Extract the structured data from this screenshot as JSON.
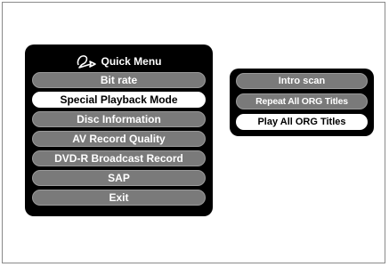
{
  "quick_menu": {
    "title": "Quick Menu",
    "logo_icon": "pioneer-logo-icon",
    "items": [
      {
        "label": "Bit rate",
        "selected": false
      },
      {
        "label": "Special Playback Mode",
        "selected": true
      },
      {
        "label": "Disc Information",
        "selected": false
      },
      {
        "label": "AV Record Quality",
        "selected": false
      },
      {
        "label": "DVD-R Broadcast Record",
        "selected": false
      },
      {
        "label": "SAP",
        "selected": false
      },
      {
        "label": "Exit",
        "selected": false
      }
    ]
  },
  "submenu": {
    "items": [
      {
        "label": "Intro scan",
        "selected": false
      },
      {
        "label": "Repeat All ORG Titles",
        "selected": false
      },
      {
        "label": "Play All ORG Titles",
        "selected": true
      }
    ]
  },
  "colors": {
    "panel": "#000000",
    "item": "#7a7a7a",
    "item_selected": "#ffffff"
  }
}
